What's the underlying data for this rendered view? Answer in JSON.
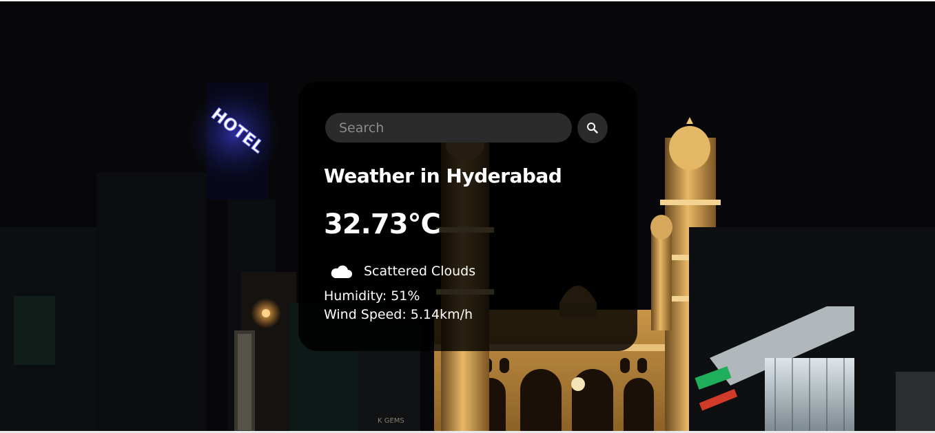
{
  "search": {
    "placeholder": "Search",
    "value": ""
  },
  "weather": {
    "title": "Weather in Hyderabad",
    "temperature": "32.73°C",
    "condition": "Scattered Clouds",
    "condition_icon": "cloud-icon",
    "humidity": "Humidity: 51%",
    "wind": "Wind Speed: 5.14km/h"
  },
  "background": {
    "sign_text": "HOTEL",
    "shop_sign_text": "K GEMS"
  },
  "colors": {
    "card_bg": "#000000",
    "input_bg": "#2b2b2b",
    "text": "#ffffff",
    "sign_glow": "#3a3cff",
    "monument": "#d9a24a"
  }
}
